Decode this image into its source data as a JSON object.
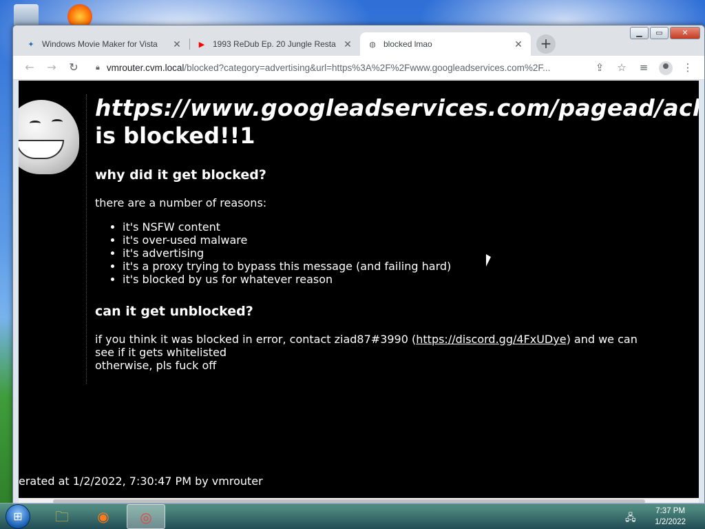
{
  "browser": {
    "tabs": [
      {
        "title": "Windows Movie Maker for Vista",
        "favicon": "movie-maker-icon",
        "favicon_glyph": "✦",
        "favicon_color": "#2b6cb0",
        "active": false
      },
      {
        "title": "1993 ReDub Ep. 20 Jungle Resta",
        "favicon": "youtube-icon",
        "favicon_glyph": "▶",
        "favicon_color": "#ff0000",
        "active": false
      },
      {
        "title": "blocked lmao",
        "favicon": "globe-icon",
        "favicon_glyph": "◍",
        "favicon_color": "#5f6368",
        "active": true
      }
    ],
    "new_tab_label": "+",
    "close_glyph": "✕",
    "address": {
      "host": "vmrouter.cvm.local",
      "rest": "/blocked?category=advertising&url=https%3A%2F%2Fwww.googleadservices.com%2F..."
    }
  },
  "page": {
    "blocked_url": "https://www.googleadservices.com/pagead/aclk",
    "blocked_suffix": "is blocked!!1",
    "why_heading": "why did it get blocked?",
    "reasons_intro": "there are a number of reasons:",
    "reasons": [
      "it's NSFW content",
      "it's over-used malware",
      "it's advertising",
      "it's a proxy trying to bypass this message (and failing hard)",
      "it's blocked by us for whatever reason"
    ],
    "unblock_heading": "can it get unblocked?",
    "unblock_before": "if you think it was blocked in error, contact ziad87#3990 (",
    "unblock_link": "https://discord.gg/4FxUDye",
    "unblock_after": ") and we can see if it gets whitelisted",
    "otherwise": "otherwise, pls fuck off",
    "footer": "erated at 1/2/2022, 7:30:47 PM by vmrouter"
  },
  "taskbar": {
    "items": [
      {
        "name": "file-explorer-icon",
        "glyph": "🗀"
      },
      {
        "name": "firefox-icon",
        "glyph": "◉"
      },
      {
        "name": "chrome-icon",
        "glyph": "◎"
      }
    ],
    "time": "7:37 PM",
    "date": "1/2/2022"
  },
  "colors": {
    "page_background": "#000000",
    "page_text": "#ffffff",
    "tab_strip": "#dee1e6"
  }
}
